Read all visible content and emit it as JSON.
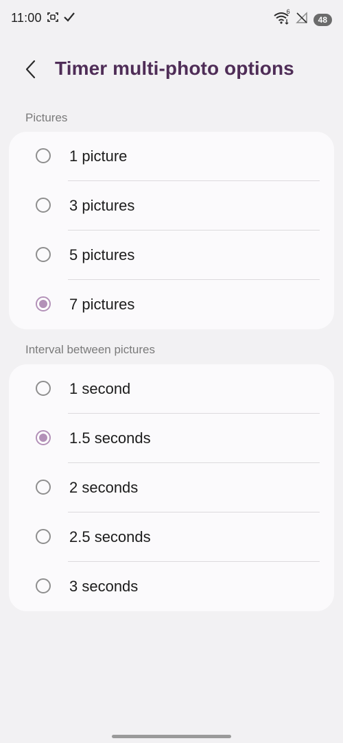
{
  "status_bar": {
    "time": "11:00",
    "battery": "48",
    "signal_badge": "6"
  },
  "header": {
    "title": "Timer multi-photo options"
  },
  "sections": [
    {
      "label": "Pictures",
      "options": [
        {
          "label": "1 picture",
          "checked": false
        },
        {
          "label": "3 pictures",
          "checked": false
        },
        {
          "label": "5 pictures",
          "checked": false
        },
        {
          "label": "7 pictures",
          "checked": true
        }
      ]
    },
    {
      "label": "Interval between pictures",
      "options": [
        {
          "label": "1 second",
          "checked": false
        },
        {
          "label": "1.5 seconds",
          "checked": true
        },
        {
          "label": "2 seconds",
          "checked": false
        },
        {
          "label": "2.5 seconds",
          "checked": false
        },
        {
          "label": "3 seconds",
          "checked": false
        }
      ]
    }
  ],
  "colors": {
    "accent": "#b391b8",
    "title": "#4f2d57",
    "background": "#f2f1f3",
    "card": "#fbfafc"
  }
}
